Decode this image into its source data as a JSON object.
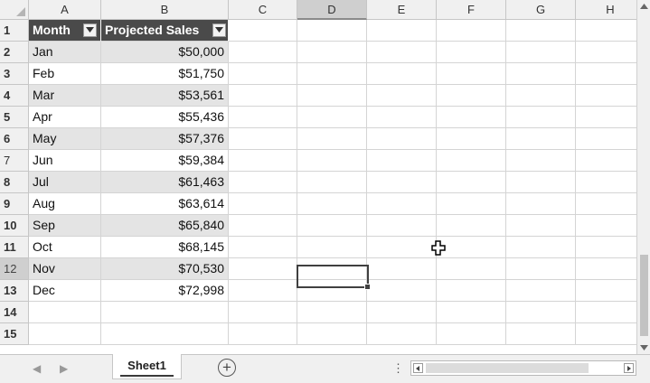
{
  "columns": [
    "A",
    "B",
    "C",
    "D",
    "E",
    "F",
    "G",
    "H"
  ],
  "rows": [
    "1",
    "2",
    "3",
    "4",
    "5",
    "6",
    "7",
    "8",
    "9",
    "10",
    "11",
    "12",
    "13",
    "14",
    "15"
  ],
  "table": {
    "headers": [
      "Month",
      "Projected Sales"
    ],
    "data": [
      [
        "Jan",
        "$50,000"
      ],
      [
        "Feb",
        "$51,750"
      ],
      [
        "Mar",
        "$53,561"
      ],
      [
        "Apr",
        "$55,436"
      ],
      [
        "May",
        "$57,376"
      ],
      [
        "Jun",
        "$59,384"
      ],
      [
        "Jul",
        "$61,463"
      ],
      [
        "Aug",
        "$63,614"
      ],
      [
        "Sep",
        "$65,840"
      ],
      [
        "Oct",
        "$68,145"
      ],
      [
        "Nov",
        "$70,530"
      ],
      [
        "Dec",
        "$72,998"
      ]
    ]
  },
  "selected_column": "D",
  "selected_row": "12",
  "sheet_tabs": [
    {
      "label": "Sheet1",
      "active": true
    }
  ],
  "add_sheet_symbol": "+",
  "icons": {
    "corner": "select-all-triangle-icon",
    "cursor": "cell-select-cross-icon",
    "filter": "filter-dropdown-icon"
  },
  "colors": {
    "header_fill": "#4a4a4a",
    "band_fill": "#e4e4e4",
    "selected_header": "#cfcfcf"
  }
}
